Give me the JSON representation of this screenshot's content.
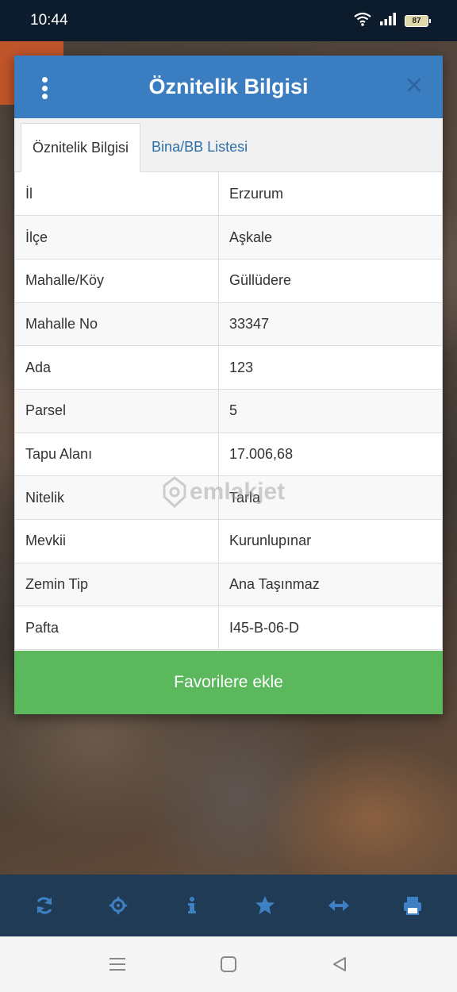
{
  "status_bar": {
    "time": "10:44",
    "battery": "87"
  },
  "dialog": {
    "title": "Öznitelik Bilgisi",
    "tabs": [
      {
        "label": "Öznitelik Bilgisi",
        "active": true
      },
      {
        "label": "Bina/BB Listesi",
        "active": false
      }
    ],
    "rows": [
      {
        "key": "İl",
        "value": "Erzurum"
      },
      {
        "key": "İlçe",
        "value": "Aşkale"
      },
      {
        "key": "Mahalle/Köy",
        "value": "Güllüdere"
      },
      {
        "key": "Mahalle No",
        "value": "33347"
      },
      {
        "key": "Ada",
        "value": "123"
      },
      {
        "key": "Parsel",
        "value": "5"
      },
      {
        "key": "Tapu Alanı",
        "value": "17.006,68"
      },
      {
        "key": "Nitelik",
        "value": "Tarla"
      },
      {
        "key": "Mevkii",
        "value": "Kurunlupınar"
      },
      {
        "key": "Zemin Tip",
        "value": "Ana Taşınmaz"
      },
      {
        "key": "Pafta",
        "value": "I45-B-06-D"
      }
    ],
    "favorite_button": "Favorilere ekle"
  },
  "watermark": "emlakjet",
  "colors": {
    "header": "#3a7ec1",
    "favorite": "#5cb85c",
    "toolbar": "#1f3b56",
    "toolbar_icon": "#3d80c4"
  },
  "toolbar_icons": [
    "refresh-icon",
    "crosshair-icon",
    "info-icon",
    "star-icon",
    "measure-icon",
    "print-icon"
  ],
  "nav_icons": [
    "menu-icon",
    "home-icon",
    "back-icon"
  ]
}
